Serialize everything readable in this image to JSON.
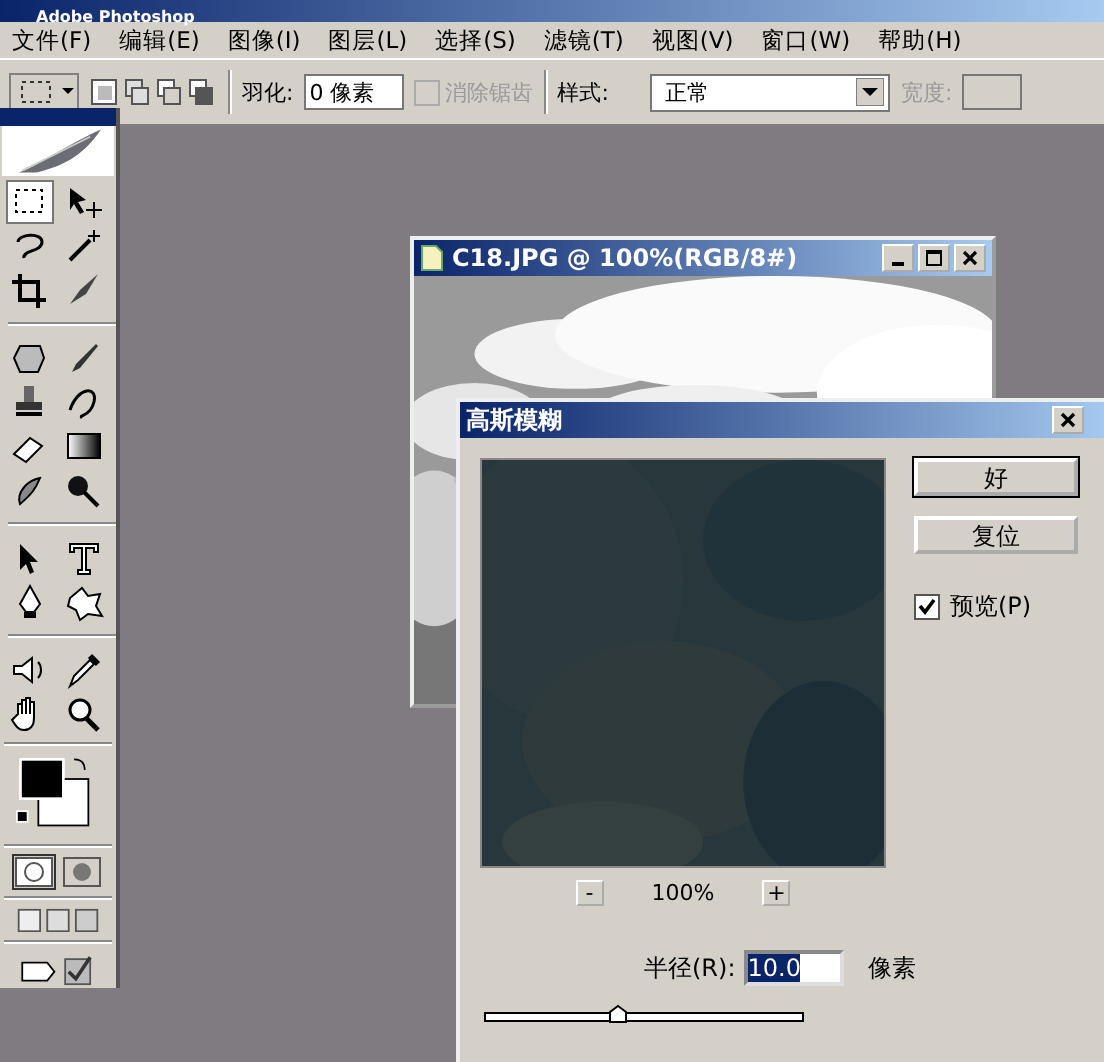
{
  "app_title": "Adobe Photoshop",
  "menu": [
    "文件(F)",
    "编辑(E)",
    "图像(I)",
    "图层(L)",
    "选择(S)",
    "滤镜(T)",
    "视图(V)",
    "窗口(W)",
    "帮助(H)"
  ],
  "options_bar": {
    "feather_label": "羽化:",
    "feather_value": "0 像素",
    "antialias": {
      "label": "消除锯齿",
      "checked": false,
      "disabled": true
    },
    "style_label": "样式:",
    "style_value": "正常",
    "width_label": "宽度:"
  },
  "document": {
    "title": "C18.JPG @ 100%(RGB/8#)"
  },
  "dialog": {
    "title": "高斯模糊",
    "buttons": [
      "好",
      "复位"
    ],
    "preview": {
      "label": "预览(P)",
      "checked": true
    },
    "zoom_out": "-",
    "zoom": "100%",
    "zoom_in": "+",
    "radius_label": "半径(R):",
    "radius_value": "10.0",
    "radius_unit": "像素",
    "slider": {
      "level": 0.42
    }
  }
}
